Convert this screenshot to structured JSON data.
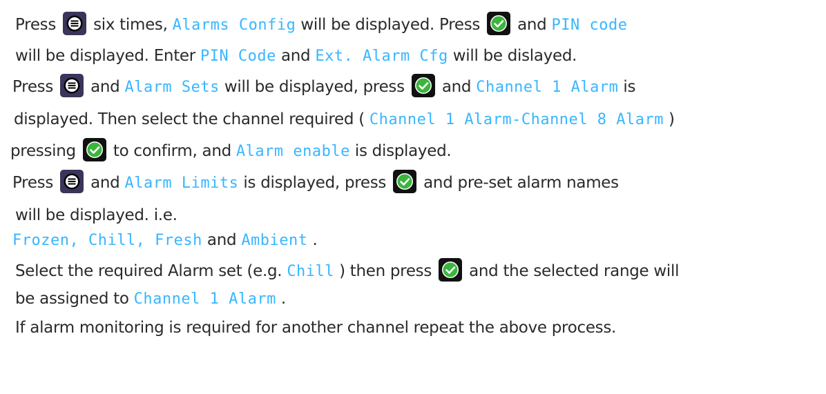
{
  "icons": {
    "menu_button": "menu-button-icon",
    "ok_button": "confirm-check-button-icon"
  },
  "colors": {
    "lcd_text": "#38b6ff",
    "menu_button_bg": "#3a3559",
    "ok_button_bg": "#111111",
    "ok_circle": "#3cb53f",
    "body_text": "#2a2a2a"
  },
  "lines": {
    "l1": {
      "t1": "Press ",
      "t2": " six times, ",
      "c1": "Alarms Config",
      "t3": " will be displayed. Press ",
      "t4": " and ",
      "c2": "PIN code"
    },
    "l2": {
      "t1": "will be displayed. Enter ",
      "c1": "PIN Code",
      "t2": " and ",
      "c2": "Ext. Alarm Cfg",
      "t3": " will be dislayed."
    },
    "l3": {
      "t1": "Press ",
      "t2": " and ",
      "c1": "Alarm Sets",
      "t3": " will be displayed, press ",
      "t4": " and ",
      "c2": "Channel 1 Alarm",
      "t5": " is"
    },
    "l4": {
      "t1": "displayed. Then select the channel required ( ",
      "c1": "Channel 1 Alarm-Channel 8 Alarm",
      "t2": " )"
    },
    "l5": {
      "t1": "pressing ",
      "t2": " to confirm, and ",
      "c1": "Alarm enable",
      "t3": " is displayed."
    },
    "l6": {
      "t1": "Press ",
      "t2": " and ",
      "c1": "Alarm Limits",
      "t3": " is displayed,  press ",
      "t4": " and pre-set alarm names"
    },
    "l7": {
      "t1": "will be displayed. i.e."
    },
    "l8": {
      "c1": "Frozen, Chill, Fresh",
      "t1": " and ",
      "c2": "Ambient",
      "t2": "."
    },
    "l9": {
      "t1": "Select the required Alarm set (e.g. ",
      "c1": "Chill",
      "t2": ") then press ",
      "t3": " and the selected range will"
    },
    "l10": {
      "t1": "be assigned to ",
      "c1": "Channel 1 Alarm",
      "t2": "."
    },
    "l11": {
      "t1": "If alarm monitoring is required for another channel repeat the above process."
    }
  }
}
